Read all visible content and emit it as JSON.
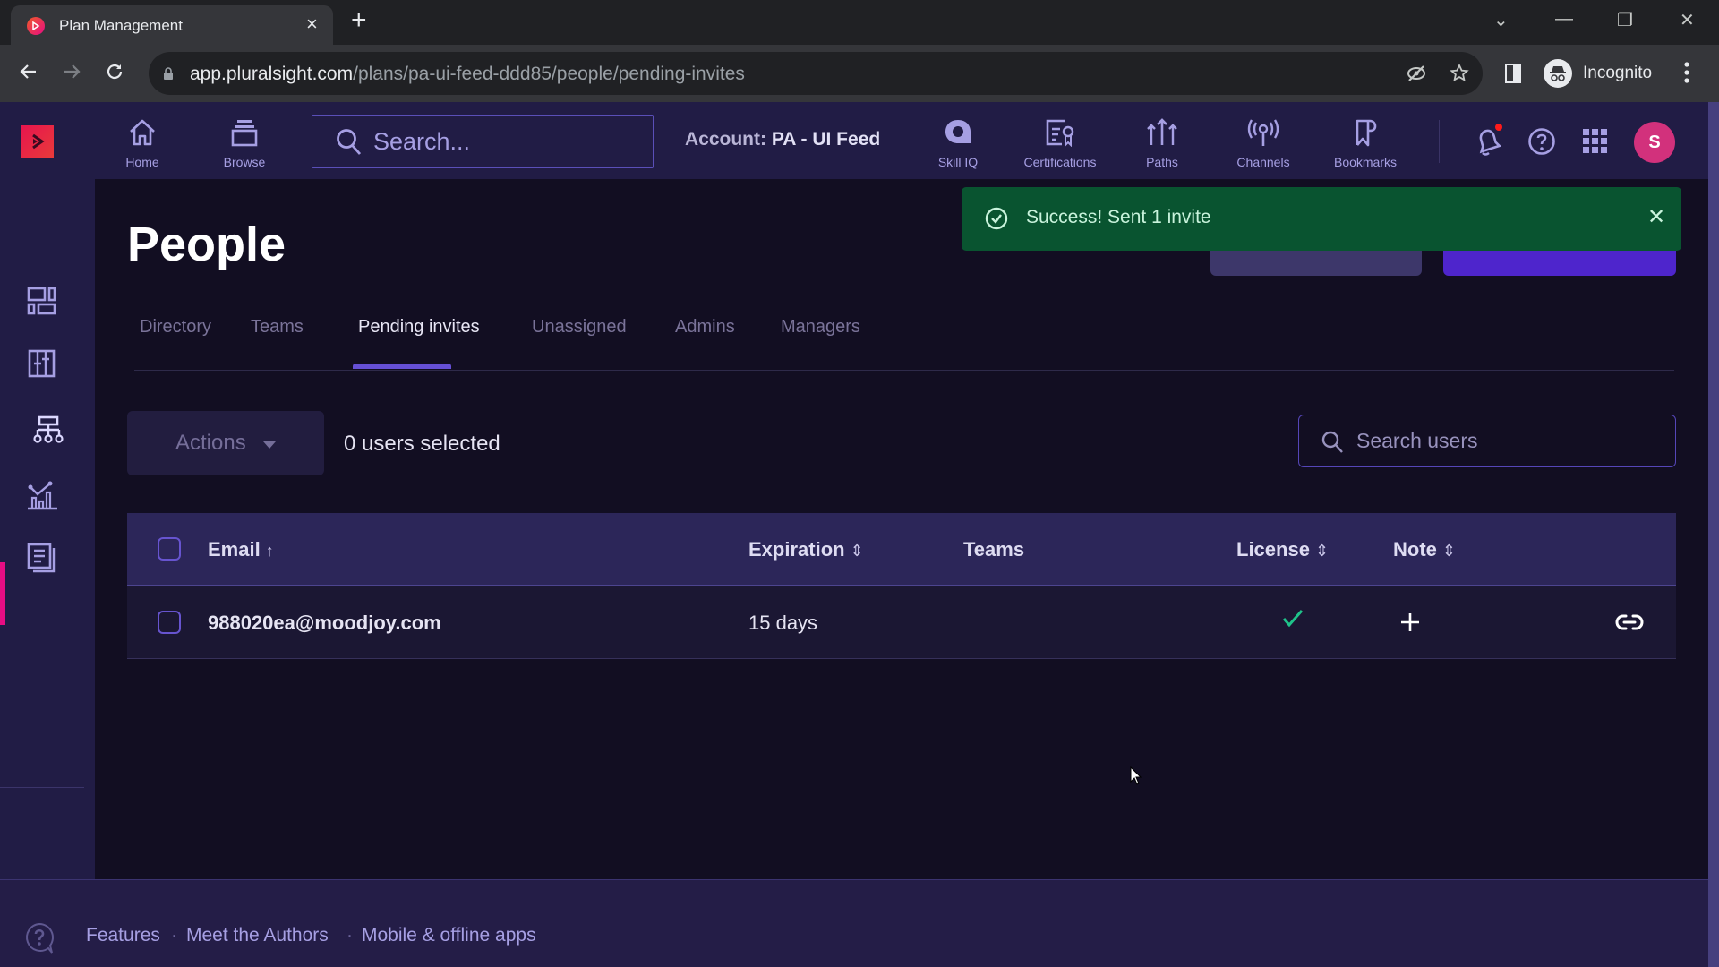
{
  "browser": {
    "tab_title": "Plan Management",
    "tab_close": "×",
    "new_tab": "+",
    "url_host": "app.pluralsight.com",
    "url_path": "/plans/pa-ui-feed-ddd85/people/pending-invites",
    "profile_label": "Incognito",
    "window_controls": {
      "tab_search": "⌄",
      "minimize": "—",
      "restore": "❐",
      "close": "✕"
    }
  },
  "appnav": {
    "items": [
      {
        "label": "Home",
        "icon": "home-icon"
      },
      {
        "label": "Browse",
        "icon": "browse-icon"
      },
      {
        "label": "Skill IQ",
        "icon": "skill-iq-icon"
      },
      {
        "label": "Certifications",
        "icon": "certifications-icon"
      },
      {
        "label": "Paths",
        "icon": "paths-icon"
      },
      {
        "label": "Channels",
        "icon": "channels-icon"
      },
      {
        "label": "Bookmarks",
        "icon": "bookmarks-icon"
      }
    ],
    "search_placeholder": "Search...",
    "account_key": "Account:",
    "account_value": "PA - UI Feed",
    "avatar_initial": "S"
  },
  "sidebar": {
    "items": [
      {
        "icon": "dashboard-icon",
        "active": false
      },
      {
        "icon": "plan-icon",
        "active": false
      },
      {
        "icon": "people-hierarchy-icon",
        "active": true
      },
      {
        "icon": "analytics-icon",
        "active": false
      },
      {
        "icon": "reports-icon",
        "active": false
      }
    ]
  },
  "page": {
    "title": "People",
    "tabs": [
      {
        "label": "Directory",
        "active": false
      },
      {
        "label": "Teams",
        "active": false
      },
      {
        "label": "Pending invites",
        "active": true
      },
      {
        "label": "Unassigned",
        "active": false
      },
      {
        "label": "Admins",
        "active": false
      },
      {
        "label": "Managers",
        "active": false
      }
    ],
    "actions_label": "Actions",
    "selected_count": "0 users selected",
    "search_placeholder": "Search users"
  },
  "table": {
    "columns": [
      {
        "label": "Email",
        "sort": "↑"
      },
      {
        "label": "Expiration",
        "sort": "⇕"
      },
      {
        "label": "Teams",
        "sort": ""
      },
      {
        "label": "License",
        "sort": "⇕"
      },
      {
        "label": "Note",
        "sort": "⇕"
      }
    ],
    "rows": [
      {
        "email": "988020ea@moodjoy.com",
        "expiration": "15 days",
        "teams": "",
        "license": "✓",
        "note_action": "+",
        "row_action": "link-icon"
      }
    ]
  },
  "toast": {
    "message": "Success! Sent 1 invite",
    "close": "✕",
    "status_color": "#095430"
  },
  "footer": {
    "links": [
      "Features",
      "Meet the Authors",
      "Mobile & offline apps"
    ],
    "separator": "·"
  },
  "colors": {
    "accent": "#6650d6",
    "brand_pink": "#e70d83",
    "license_check": "#1fc38a"
  }
}
